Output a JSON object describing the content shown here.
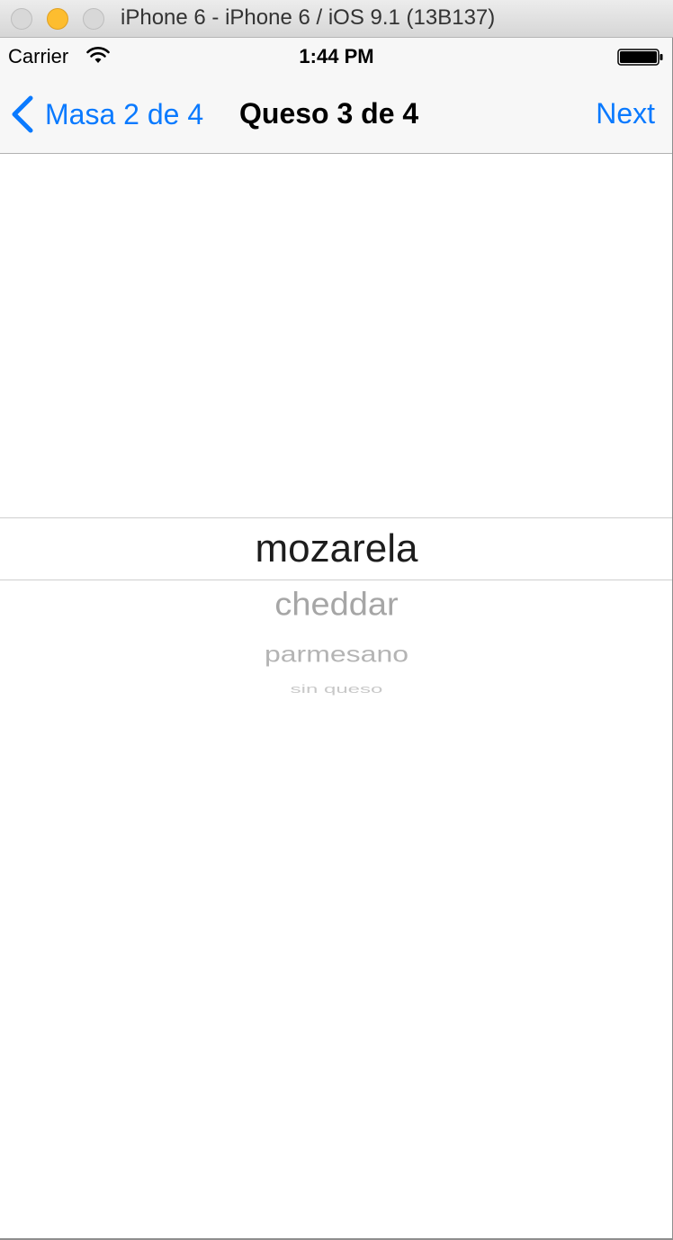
{
  "window": {
    "title": "iPhone 6 - iPhone 6 / iOS 9.1 (13B137)"
  },
  "status_bar": {
    "carrier": "Carrier",
    "time": "1:44 PM",
    "icons": [
      "wifi-icon",
      "battery-icon"
    ]
  },
  "nav_bar": {
    "back_label": "Masa 2 de 4",
    "title": "Queso 3 de 4",
    "next_label": "Next",
    "tint_color": "#0a7aff"
  },
  "picker": {
    "selected": "mozarela",
    "options": [
      "cheddar",
      "parmesano",
      "sin queso"
    ]
  }
}
